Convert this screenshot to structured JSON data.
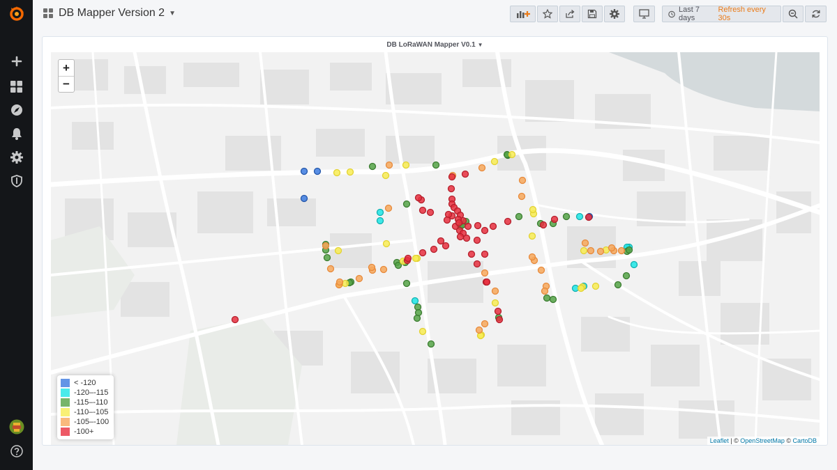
{
  "header": {
    "dashboard_title": "DB Mapper Version 2",
    "time_range": "Last 7 days",
    "refresh": "Refresh every 30s"
  },
  "panel": {
    "title": "DB LoRaWAN Mapper V0.1",
    "legend": [
      {
        "label": "< -120",
        "color": "#3c7be0"
      },
      {
        "label": "-120–-115",
        "color": "#1de6e6"
      },
      {
        "label": "-115–-110",
        "color": "#55a346"
      },
      {
        "label": "-110–-105",
        "color": "#f8ec53"
      },
      {
        "label": "-105–-100",
        "color": "#f7a85c"
      },
      {
        "label": "-100+",
        "color": "#e8303f"
      }
    ],
    "attribution": {
      "leaflet": "Leaflet",
      "sep1": " | © ",
      "osm": "OpenStreetMap",
      "sep2": " © ",
      "carto": "CartoDB"
    }
  },
  "map_controls": {
    "zoom_in": "+",
    "zoom_out": "−"
  },
  "map_points": [
    [
      363,
      171,
      0
    ],
    [
      382,
      171,
      0
    ],
    [
      363,
      210,
      0
    ],
    [
      772,
      236,
      0
    ],
    [
      472,
      230,
      1
    ],
    [
      472,
      242,
      1
    ],
    [
      758,
      236,
      1
    ],
    [
      829,
      280,
      1
    ],
    [
      826,
      280,
      1
    ],
    [
      836,
      305,
      1
    ],
    [
      752,
      339,
      1
    ],
    [
      764,
      336,
      1
    ],
    [
      522,
      357,
      1
    ],
    [
      461,
      164,
      2
    ],
    [
      552,
      162,
      2
    ],
    [
      655,
      148,
      2
    ],
    [
      394,
      276,
      2
    ],
    [
      394,
      284,
      2
    ],
    [
      396,
      295,
      2
    ],
    [
      510,
      218,
      2
    ],
    [
      671,
      236,
      2
    ],
    [
      702,
      246,
      2
    ],
    [
      739,
      236,
      2
    ],
    [
      720,
      246,
      2
    ],
    [
      508,
      302,
      2
    ],
    [
      496,
      302,
      2
    ],
    [
      430,
      330,
      2
    ],
    [
      510,
      332,
      2
    ],
    [
      526,
      366,
      2
    ],
    [
      527,
      374,
      2
    ],
    [
      525,
      382,
      2
    ],
    [
      545,
      419,
      2
    ],
    [
      642,
      381,
      2
    ],
    [
      711,
      353,
      2
    ],
    [
      720,
      355,
      2
    ],
    [
      813,
      334,
      2
    ],
    [
      825,
      321,
      2
    ],
    [
      654,
      147,
      2
    ],
    [
      587,
      250,
      2
    ],
    [
      826,
      286,
      2
    ],
    [
      590,
      248,
      2
    ],
    [
      498,
      306,
      2
    ],
    [
      428,
      331,
      2
    ],
    [
      595,
      243,
      2
    ],
    [
      829,
      284,
      2
    ],
    [
      410,
      173,
      3
    ],
    [
      429,
      172,
      3
    ],
    [
      509,
      162,
      3
    ],
    [
      636,
      157,
      3
    ],
    [
      661,
      147,
      3
    ],
    [
      481,
      275,
      3
    ],
    [
      412,
      285,
      3
    ],
    [
      422,
      332,
      3
    ],
    [
      414,
      333,
      3
    ],
    [
      781,
      336,
      3
    ],
    [
      762,
      337,
      3
    ],
    [
      760,
      339,
      3
    ],
    [
      690,
      264,
      3
    ],
    [
      692,
      232,
      3
    ],
    [
      764,
      285,
      3
    ],
    [
      525,
      296,
      3
    ],
    [
      637,
      360,
      3
    ],
    [
      533,
      401,
      3
    ],
    [
      617,
      406,
      3
    ],
    [
      523,
      296,
      3
    ],
    [
      691,
      226,
      3
    ],
    [
      796,
      284,
      3
    ],
    [
      616,
      407,
      3
    ],
    [
      480,
      177,
      3
    ],
    [
      505,
      300,
      3
    ],
    [
      485,
      162,
      4
    ],
    [
      618,
      166,
      4
    ],
    [
      576,
      177,
      4
    ],
    [
      676,
      184,
      4
    ],
    [
      675,
      207,
      4
    ],
    [
      484,
      224,
      4
    ],
    [
      394,
      278,
      4
    ],
    [
      401,
      311,
      4
    ],
    [
      413,
      334,
      4
    ],
    [
      414,
      330,
      4
    ],
    [
      442,
      325,
      4
    ],
    [
      461,
      313,
      4
    ],
    [
      477,
      312,
      4
    ],
    [
      693,
      299,
      4
    ],
    [
      703,
      313,
      4
    ],
    [
      710,
      336,
      4
    ],
    [
      708,
      343,
      4
    ],
    [
      637,
      343,
      4
    ],
    [
      690,
      294,
      4
    ],
    [
      622,
      317,
      4
    ],
    [
      807,
      285,
      4
    ],
    [
      818,
      285,
      4
    ],
    [
      766,
      274,
      4
    ],
    [
      774,
      285,
      4
    ],
    [
      788,
      286,
      4
    ],
    [
      804,
      281,
      4
    ],
    [
      622,
      390,
      4
    ],
    [
      614,
      399,
      4
    ],
    [
      460,
      309,
      4
    ],
    [
      575,
      179,
      5
    ],
    [
      574,
      196,
      5
    ],
    [
      575,
      211,
      5
    ],
    [
      575,
      218,
      5
    ],
    [
      578,
      223,
      5
    ],
    [
      583,
      228,
      5
    ],
    [
      587,
      234,
      5
    ],
    [
      591,
      242,
      5
    ],
    [
      586,
      256,
      5
    ],
    [
      591,
      260,
      5
    ],
    [
      598,
      250,
      5
    ],
    [
      612,
      249,
      5
    ],
    [
      622,
      256,
      5
    ],
    [
      634,
      250,
      5
    ],
    [
      655,
      243,
      5
    ],
    [
      575,
      235,
      5
    ],
    [
      584,
      240,
      5
    ],
    [
      570,
      233,
      5
    ],
    [
      580,
      250,
      5
    ],
    [
      587,
      265,
      5
    ],
    [
      596,
      267,
      5
    ],
    [
      603,
      290,
      5
    ],
    [
      611,
      304,
      5
    ],
    [
      624,
      330,
      5
    ],
    [
      641,
      372,
      5
    ],
    [
      643,
      384,
      5
    ],
    [
      611,
      270,
      5
    ],
    [
      622,
      290,
      5
    ],
    [
      625,
      330,
      5
    ],
    [
      566,
      278,
      5
    ],
    [
      549,
      283,
      5
    ],
    [
      533,
      288,
      5
    ],
    [
      511,
      299,
      5
    ],
    [
      512,
      296,
      5
    ],
    [
      531,
      212,
      5
    ],
    [
      527,
      209,
      5
    ],
    [
      533,
      227,
      5
    ],
    [
      544,
      230,
      5
    ],
    [
      559,
      271,
      5
    ],
    [
      594,
      175,
      5
    ],
    [
      706,
      248,
      5
    ],
    [
      722,
      240,
      5
    ],
    [
      771,
      237,
      5
    ],
    [
      264,
      384,
      5
    ],
    [
      568,
      241,
      5
    ],
    [
      585,
      245,
      5
    ]
  ]
}
